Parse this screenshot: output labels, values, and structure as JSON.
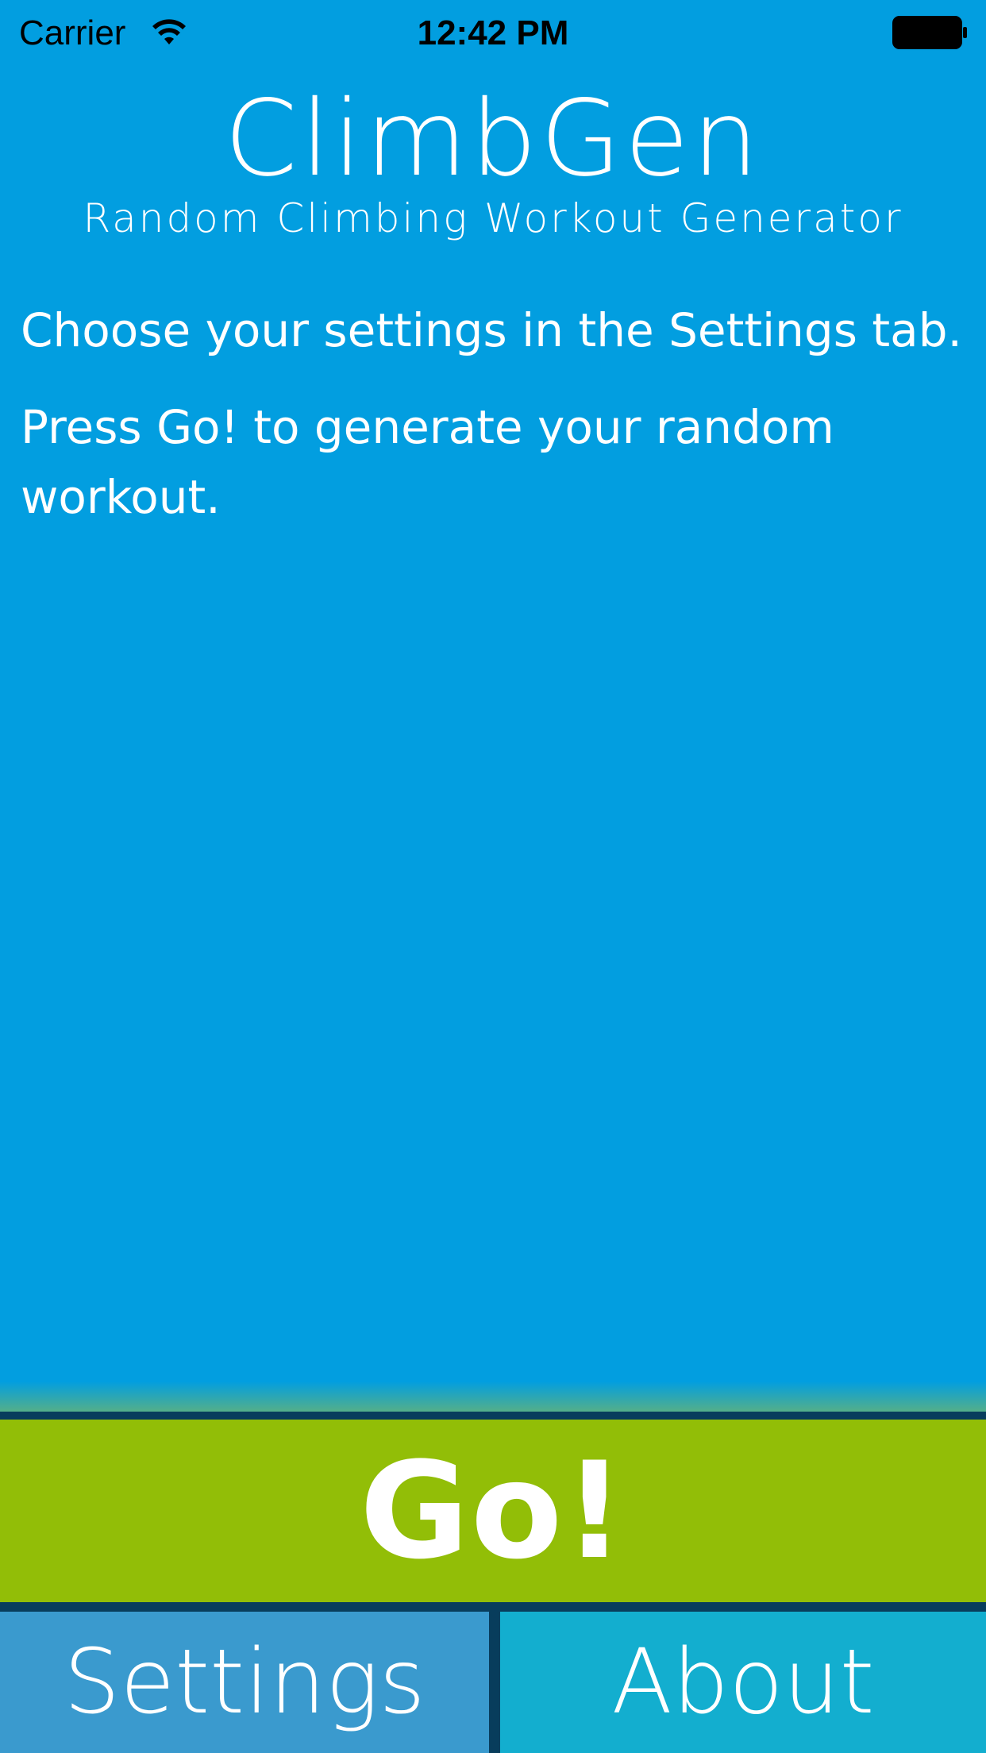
{
  "status_bar": {
    "carrier": "Carrier",
    "time": "12:42 PM",
    "wifi_icon": "wifi-icon",
    "battery_icon": "battery-icon"
  },
  "header": {
    "title": "ClimbGen",
    "subtitle": "Random Climbing Workout Generator"
  },
  "instructions": [
    "Choose your settings in the Settings tab.",
    "Press Go! to generate your random workout."
  ],
  "go_button": {
    "label": "Go!"
  },
  "tabs": [
    {
      "label": "Settings"
    },
    {
      "label": "About"
    }
  ],
  "colors": {
    "background": "#029ee0",
    "go_button": "#92be07",
    "divider": "#083d5c",
    "tab_settings": "#3a9ace",
    "tab_about": "#13aecf",
    "text": "#ffffff"
  }
}
